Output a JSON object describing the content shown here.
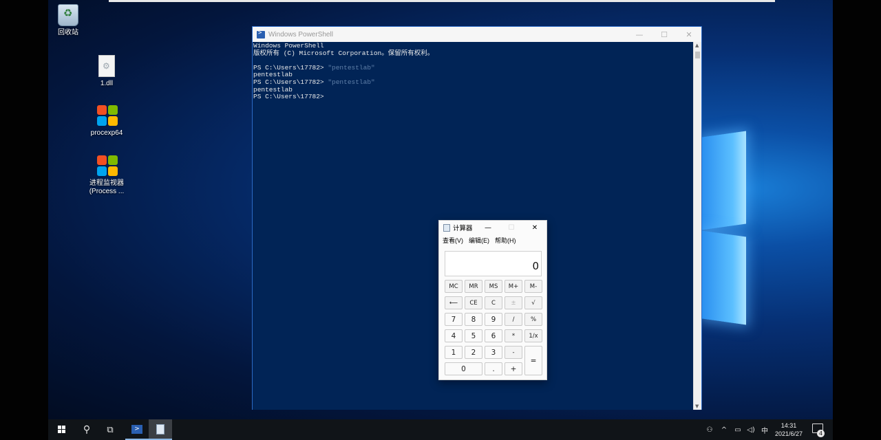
{
  "desktop": {
    "icons": [
      {
        "label": "回收站"
      },
      {
        "label": "1.dll"
      },
      {
        "label": "procexp64"
      },
      {
        "label_line1": "进程监视器",
        "label_line2": "(Process ..."
      }
    ]
  },
  "powershell": {
    "title": "Windows PowerShell",
    "controls": {
      "minimize": "—",
      "maximize": "☐",
      "close": "✕"
    },
    "lines": [
      {
        "text": "Windows PowerShell",
        "type": "output"
      },
      {
        "text": "版权所有 (C) Microsoft Corporation。保留所有权利。",
        "type": "output"
      },
      {
        "text": "",
        "type": "output"
      },
      {
        "prompt": "PS C:\\Users\\17782> ",
        "cmd": "\"pentestlab\"",
        "type": "input"
      },
      {
        "text": "pentestlab",
        "type": "output"
      },
      {
        "prompt": "PS C:\\Users\\17782> ",
        "cmd": "\"pentestlab\"",
        "type": "input"
      },
      {
        "text": "pentestlab",
        "type": "output"
      },
      {
        "prompt": "PS C:\\Users\\17782>",
        "cmd": "",
        "type": "input"
      }
    ]
  },
  "calculator": {
    "title": "计算器",
    "controls": {
      "minimize": "—",
      "maximize": "☐",
      "close": "✕"
    },
    "menu": [
      "查看(V)",
      "编辑(E)",
      "帮助(H)"
    ],
    "display": "0",
    "keys": {
      "mc": "MC",
      "mr": "MR",
      "ms": "MS",
      "mplus": "M+",
      "mminus": "M-",
      "back": "⟵",
      "ce": "CE",
      "c": "C",
      "plusminus": "±",
      "sqrt": "√",
      "k7": "7",
      "k8": "8",
      "k9": "9",
      "div": "/",
      "pct": "%",
      "k4": "4",
      "k5": "5",
      "k6": "6",
      "mul": "*",
      "recip": "1/x",
      "k1": "1",
      "k2": "2",
      "k3": "3",
      "minus": "-",
      "eq": "=",
      "k0": "0",
      "dot": ".",
      "plus": "+"
    }
  },
  "taskbar": {
    "start_icon": "windows-start-icon",
    "search_icon": "search-icon",
    "taskview_icon": "task-view-icon",
    "tray": {
      "people": "⚇",
      "chevron": "^",
      "network": "▭",
      "volume": "◁)",
      "ime": "中"
    },
    "time": "14:31",
    "date": "2021/6/27",
    "notification_count": "4"
  },
  "colors": {
    "powershell_bg": "#012456",
    "accent": "#2c6bc7"
  }
}
